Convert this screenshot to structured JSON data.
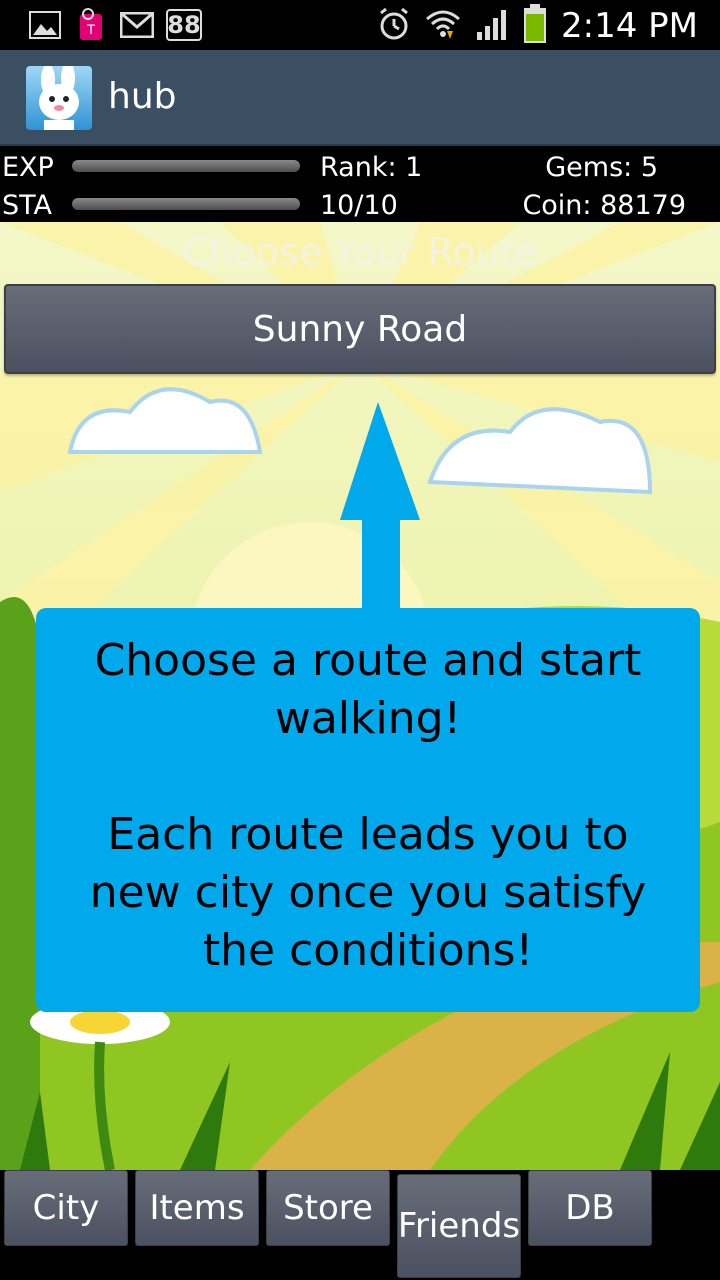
{
  "status_bar": {
    "time": "2:14 PM",
    "left_icons": [
      "gallery-icon",
      "tmobile-icon",
      "gmail-icon",
      "notification-88-icon"
    ],
    "badge_number": "88",
    "right_icons": [
      "alarm-icon",
      "wifi-icon",
      "signal-icon",
      "battery-icon"
    ]
  },
  "action_bar": {
    "title": "hub"
  },
  "stats": {
    "exp_label": "EXP",
    "sta_label": "STA",
    "rank": "Rank: 1",
    "stamina": "10/10",
    "gems": "Gems: 5",
    "coin": "Coin: 88179"
  },
  "main": {
    "title": "Choose Your Route",
    "route_button": "Sunny Road",
    "tip_line1": "Choose a route and start walking!",
    "tip_line2": "Each route leads you to new city once you satisfy the conditions!"
  },
  "tabs": [
    "City",
    "Items",
    "Store",
    "Friends",
    "DB"
  ],
  "colors": {
    "tip_bg": "#00a8ec",
    "arrow": "#00a8ec",
    "action_bar": "#3b4f63",
    "button": "#5a606b"
  }
}
